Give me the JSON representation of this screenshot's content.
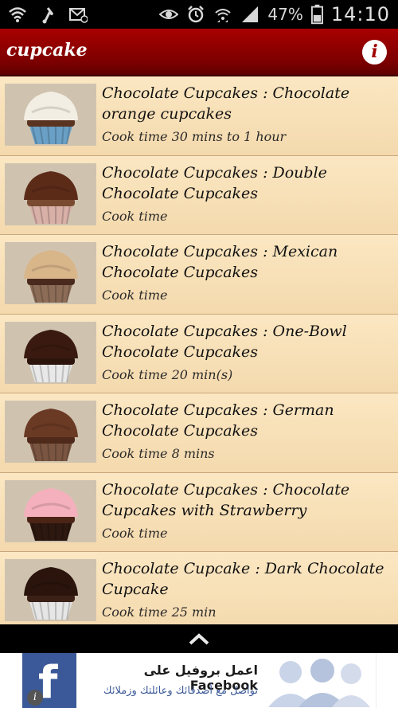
{
  "status_bar": {
    "battery_percent": "47%",
    "time": "14:10",
    "icons": [
      "wifi-icon",
      "usb-debug-icon",
      "email-notification-icon",
      "eye-icon",
      "alarm-icon",
      "wifi-signal-icon",
      "cell-signal-icon",
      "battery-icon"
    ]
  },
  "app_bar": {
    "title": "cupcake",
    "info_label": "i"
  },
  "recipes": [
    {
      "title": "Chocolate Cupcakes : Chocolate orange cupcakes",
      "cook": "Cook time 30 mins to 1 hour",
      "frosting": "#f3eee4",
      "cake": "#5a3421",
      "wrapper": "#6aa0c6"
    },
    {
      "title": "Chocolate Cupcakes : Double Chocolate Cupcakes",
      "cook": "Cook time",
      "frosting": "#5b2b18",
      "cake": "#7a4b31",
      "wrapper": "#d8b0a8"
    },
    {
      "title": "Chocolate Cupcakes : Mexican Chocolate Cupcakes",
      "cook": "Cook time",
      "frosting": "#d9b58a",
      "cake": "#4a2a1c",
      "wrapper": "#8c6c56"
    },
    {
      "title": "Chocolate Cupcakes : One-Bowl Chocolate Cupcakes",
      "cook": "Cook time 20 min(s)",
      "frosting": "#3a1a10",
      "cake": "#2c140c",
      "wrapper": "#e8e8e8"
    },
    {
      "title": "Chocolate Cupcakes : German Chocolate Cupcakes",
      "cook": "Cook time 8 mins",
      "frosting": "#6a3a24",
      "cake": "#4f2a1a",
      "wrapper": "#7a5542"
    },
    {
      "title": "Chocolate Cupcakes : Chocolate Cupcakes with Strawberry",
      "cook": "Cook time",
      "frosting": "#f4b0bc",
      "cake": "#4b2416",
      "wrapper": "#2d180f"
    },
    {
      "title": "Chocolate Cupcake : Dark Chocolate Cupcake",
      "cook": "Cook time 25 min",
      "frosting": "#2a140c",
      "cake": "#3b2016",
      "wrapper": "#e6e6e6"
    }
  ],
  "ad": {
    "logo_text": "f",
    "title": "اعمل بروفيل على Facebook",
    "subtitle": "تواصل مع أصدقائك وعائلتك وزملائك",
    "info_label": "i"
  },
  "colors": {
    "app_bar": "#8b0000",
    "list_background": "#f6e0b8",
    "facebook_blue": "#3b5998"
  }
}
